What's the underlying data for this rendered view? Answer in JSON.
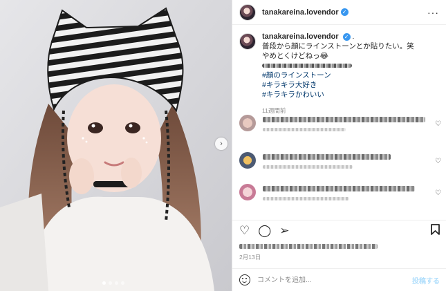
{
  "post": {
    "username": "tanakareina.lovendor",
    "verified_icon": "verified-badge-icon",
    "more_icon": "more-horizontal-icon",
    "next_icon": "chevron-right-icon",
    "carousel": {
      "slides": 4,
      "active": 0
    }
  },
  "caption": {
    "separator": ".",
    "line1": "普段から顔にラインストーンとか貼りたい。笑",
    "line2": "やめとくけどねっ😂",
    "hashtags": [
      "#顔のラインストーン",
      "#キラキラ大好き",
      "#キラキラかわいい"
    ],
    "time_ago": "11週間前"
  },
  "actions": {
    "like_icon": "heart-icon",
    "comment_icon": "comment-bubble-icon",
    "share_icon": "paper-plane-icon",
    "save_icon": "bookmark-icon"
  },
  "footer": {
    "date": "2月13日",
    "comment_placeholder": "コメントを追加...",
    "post_label": "投稿する",
    "emoji_icon": "smiley-icon"
  },
  "colors": {
    "accent": "#3897f0",
    "link": "#00376b",
    "muted": "#8e8e8e",
    "post_disabled": "#b2dffc"
  }
}
